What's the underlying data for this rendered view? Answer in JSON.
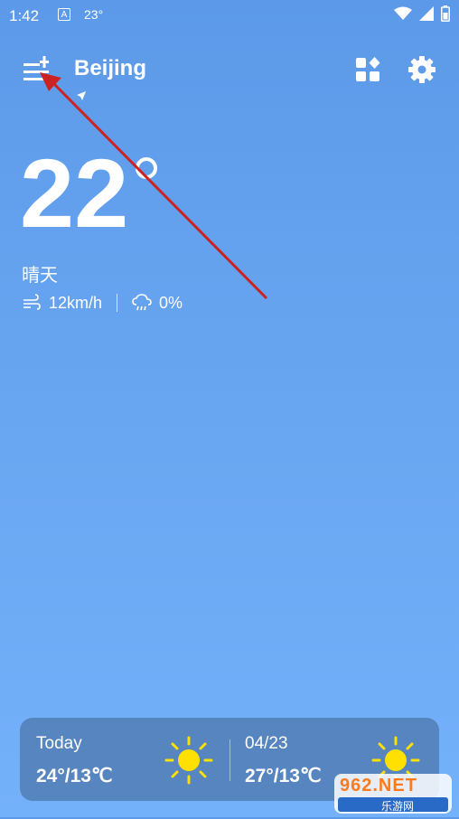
{
  "status_bar": {
    "time": "1:42",
    "notification_icon_label": "A",
    "temperature": "23°"
  },
  "header": {
    "city": "Beijing"
  },
  "current": {
    "temperature": "22",
    "degree_symbol": "°",
    "condition": "晴天",
    "wind_speed": "12km/h",
    "precipitation": "0%"
  },
  "forecast": [
    {
      "label": "Today",
      "range": "24°/13℃",
      "icon": "sun-icon"
    },
    {
      "label": "04/23",
      "range": "27°/13℃",
      "icon": "sun-icon"
    }
  ],
  "watermark": {
    "brand": "962.NET",
    "sub": "乐游网"
  },
  "colors": {
    "background_top": "#5c9ae9",
    "background_bottom": "#74b1fb",
    "card": "#4e78ad",
    "sun": "#ffe000",
    "annotation_arrow": "#cc2222"
  }
}
